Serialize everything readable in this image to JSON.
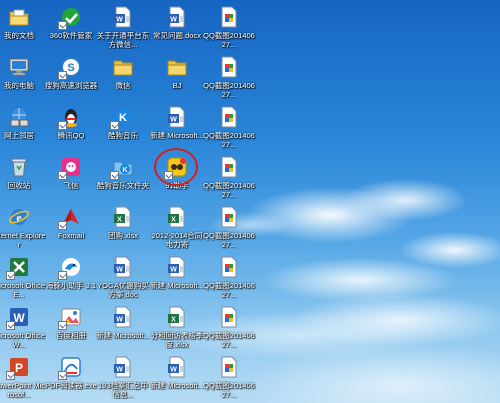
{
  "desktop": {
    "icons": [
      {
        "label": "我的文档",
        "icon": "my-documents-icon"
      },
      {
        "label": "360软件管家",
        "icon": "360-software-manager-icon"
      },
      {
        "label": "关于开通平台东方微信...",
        "icon": "word-document-icon"
      },
      {
        "label": "常见问题.docx",
        "icon": "word-document-icon"
      },
      {
        "label": "QQ截图20140627...",
        "icon": "qq-screenshot-icon"
      },
      {
        "label": "我的电脑",
        "icon": "my-computer-icon"
      },
      {
        "label": "搜狗高速浏览器",
        "icon": "sogou-browser-icon"
      },
      {
        "label": "微信",
        "icon": "folder-icon"
      },
      {
        "label": "BJ",
        "icon": "folder-icon"
      },
      {
        "label": "QQ截图20140627...",
        "icon": "qq-screenshot-icon"
      },
      {
        "label": "网上邻居",
        "icon": "network-places-icon"
      },
      {
        "label": "腾讯QQ",
        "icon": "tencent-qq-icon"
      },
      {
        "label": "酷狗音乐",
        "icon": "kugou-music-icon"
      },
      {
        "label": "新建 Microsoft...",
        "icon": "word-document-icon"
      },
      {
        "label": "QQ截图20140627...",
        "icon": "qq-screenshot-icon"
      },
      {
        "label": "回收站",
        "icon": "recycle-bin-icon"
      },
      {
        "label": "飞信",
        "icon": "fetion-icon"
      },
      {
        "label": "酷狗音乐文件夹",
        "icon": "kugou-folder-icon"
      },
      {
        "label": "91助手",
        "icon": "91-assistant-icon"
      },
      {
        "label": "QQ截图20140627...",
        "icon": "qq-screenshot-icon"
      },
      {
        "label": "Internet Explorer",
        "icon": "internet-explorer-icon"
      },
      {
        "label": "Foxmail",
        "icon": "foxmail-icon"
      },
      {
        "label": "团购.xlsx",
        "icon": "excel-document-icon"
      },
      {
        "label": "2012-2014合同电力寄",
        "icon": "excel-document-icon"
      },
      {
        "label": "QQ截图20140627...",
        "icon": "qq-screenshot-icon"
      },
      {
        "label": "Microsoft Office E...",
        "icon": "excel-app-icon"
      },
      {
        "label": "海豚小助手 3.1",
        "icon": "dolphin-assistant-icon"
      },
      {
        "label": "YOGA优惠购买方案.doc",
        "icon": "word-document-icon"
      },
      {
        "label": "新建 Microsoft...",
        "icon": "word-document-icon"
      },
      {
        "label": "QQ截图20140627...",
        "icon": "qq-screenshot-icon"
      },
      {
        "label": "Microsoft Office W...",
        "icon": "word-app-icon"
      },
      {
        "label": "百度相册",
        "icon": "baidu-album-icon"
      },
      {
        "label": "新建 Microsoft...",
        "icon": "word-document-icon"
      },
      {
        "label": "分租回访表格季度.xlsx",
        "icon": "excel-document-icon"
      },
      {
        "label": "QQ截图20140627...",
        "icon": "qq-screenshot-icon"
      },
      {
        "label": "PowerPoint Microsof...",
        "icon": "powerpoint-app-icon"
      },
      {
        "label": "PDF阅读器.exe",
        "icon": "pdf-reader-icon"
      },
      {
        "label": "193档案汇总中信息...",
        "icon": "word-document-icon"
      },
      {
        "label": "新建 Microsoft...",
        "icon": "word-document-icon"
      },
      {
        "label": "QQ截图20140627...",
        "icon": "qq-screenshot-icon"
      }
    ]
  }
}
